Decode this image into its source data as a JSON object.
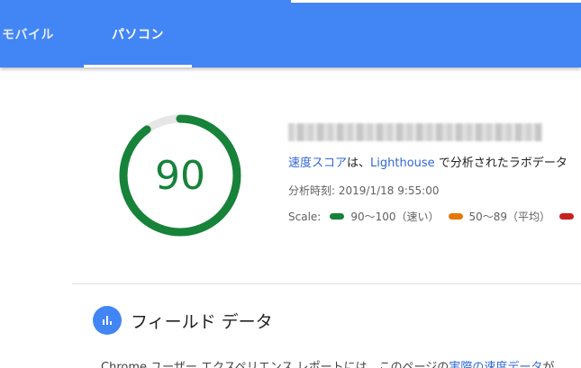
{
  "tabs": [
    {
      "label": "モバイル"
    },
    {
      "label": "パソコン"
    }
  ],
  "score": {
    "value": "90",
    "fraction": 0.9,
    "color": "#178239"
  },
  "summary": {
    "link_speed_score": "速度スコア",
    "text_1": "は、",
    "link_lighthouse": "Lighthouse",
    "text_2": " で分析されたラボデータ"
  },
  "analysis_time": "分析時刻: 2019/1/18 9:55:00",
  "scale": {
    "label": "Scale:",
    "items": [
      {
        "label": "90～100（速い）",
        "color": "#178239"
      },
      {
        "label": "50～89（平均）",
        "color": "#e67700"
      },
      {
        "label": "",
        "color": "#c7221f"
      }
    ]
  },
  "field_data": {
    "title": "フィールド データ",
    "text_1": "Chrome ユーザー エクスペリエンス レポートには、このページの",
    "link_1": "実際の速度データ",
    "text_2": "が"
  },
  "colors": {
    "header": "#4285f4",
    "link": "#3367d6"
  }
}
